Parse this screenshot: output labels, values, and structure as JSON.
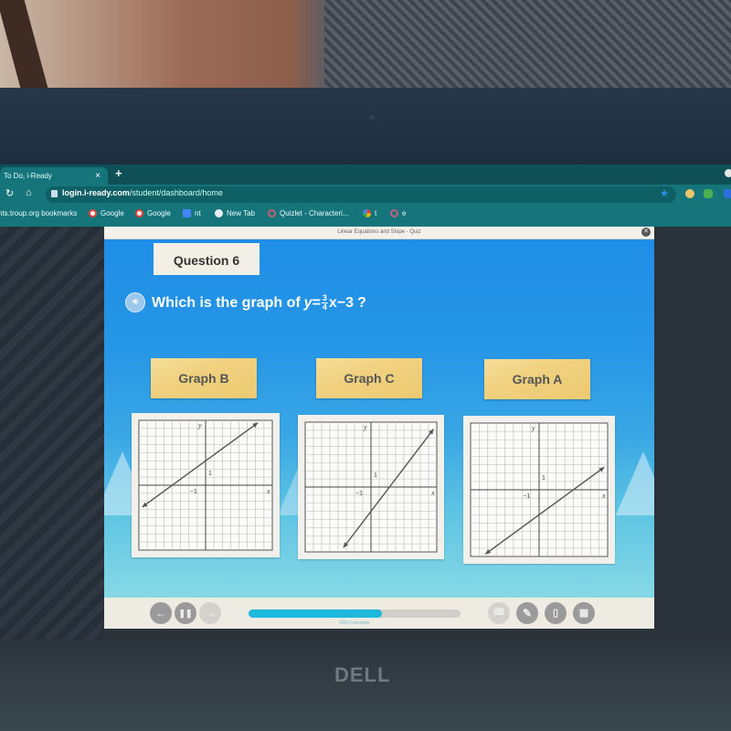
{
  "browser": {
    "tab_title": "To Do, i-Ready",
    "tab_close": "×",
    "new_tab": "+",
    "url_host": "login.i-ready.com",
    "url_path": "/student/dashboard/home",
    "bookmarks": [
      {
        "label": "nts.troup.org bookmarks",
        "icon": "folder-icon",
        "color": ""
      },
      {
        "label": "Google",
        "icon": "google-icon",
        "color": "#ea4335"
      },
      {
        "label": "Google",
        "icon": "google-icon",
        "color": "#ea4335"
      },
      {
        "label": "nt",
        "icon": "docs-icon",
        "color": "#4285f4"
      },
      {
        "label": "New Tab",
        "icon": "globe-icon",
        "color": "#9fb4c8"
      },
      {
        "label": "Quizlet - Characteri...",
        "icon": "quizlet-icon",
        "color": "#c0607a"
      },
      {
        "label": "t",
        "icon": "photos-icon",
        "color": "#f4b400"
      },
      {
        "label": "e",
        "icon": "ring-icon",
        "color": "#c0607a"
      }
    ]
  },
  "quiz": {
    "frame_title": "Linear Equations and Slope - Quiz",
    "question_label": "Question 6",
    "prompt_text": "Which is the graph of",
    "equation": {
      "lhs": "y",
      "eq": "=",
      "num": "3",
      "den": "4",
      "rest": "x−3",
      "qmark": "?"
    },
    "answers": [
      {
        "label": "Graph B"
      },
      {
        "label": "Graph C"
      },
      {
        "label": "Graph A"
      }
    ],
    "progress_percent": 63,
    "progress_label": "63% Complete"
  },
  "laptop_brand": "DELL",
  "chart_data": [
    {
      "type": "line",
      "title": "Graph B",
      "xlabel": "x",
      "ylabel": "y",
      "xlim": [
        -8,
        8
      ],
      "ylim": [
        -8,
        8
      ],
      "grid": true,
      "tick_labels": {
        "x": "-1",
        "y": "1"
      },
      "series": [
        {
          "name": "line",
          "slope": 0.75,
          "intercept": 3
        }
      ]
    },
    {
      "type": "line",
      "title": "Graph C",
      "xlabel": "x",
      "ylabel": "y",
      "xlim": [
        -8,
        8
      ],
      "ylim": [
        -8,
        8
      ],
      "grid": true,
      "tick_labels": {
        "x": "-1",
        "y": "1"
      },
      "series": [
        {
          "name": "line",
          "slope": 1.3333,
          "intercept": -3
        }
      ]
    },
    {
      "type": "line",
      "title": "Graph A",
      "xlabel": "x",
      "ylabel": "y",
      "xlim": [
        -8,
        8
      ],
      "ylim": [
        -8,
        8
      ],
      "grid": true,
      "tick_labels": {
        "x": "-1",
        "y": "1"
      },
      "series": [
        {
          "name": "line",
          "slope": 0.75,
          "intercept": -3
        }
      ]
    }
  ]
}
